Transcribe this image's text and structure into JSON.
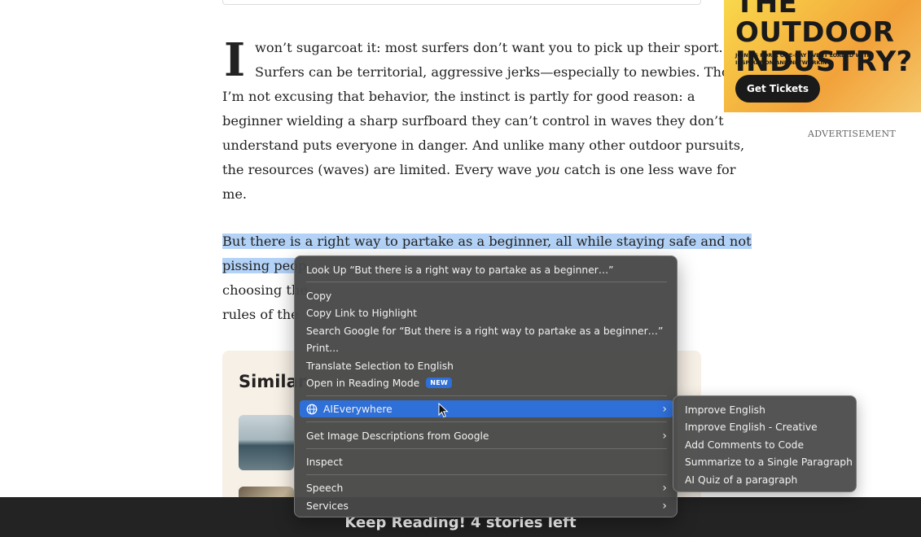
{
  "article": {
    "dropcap": "I",
    "p1_lines": [
      "won’t sugarcoat it: most surfers don’t want you to pick up their sport.",
      "Surfers can be territorial, aggressive jerks—especially to newbies. Though",
      "I’m not excusing that behavior, the instinct is partly for good reason: a",
      "beginner wielding a sharp surfboard they can’t control in waves they don’t",
      "understand puts everyone in danger. And unlike many other outdoor pursuits,",
      "the resources (waves) are limited. Every wave ",
      "you",
      " catch is one less wave for",
      "me."
    ],
    "p2_line1": "But there is a right way to partake as a beginner, all while staying safe and not",
    "p2_line2_hl": "pissing peop",
    "p2_line3": "choosing the",
    "p2_line4": "rules of the"
  },
  "similar": {
    "title": "Similar"
  },
  "ad": {
    "headline_line1": "THE OUTDOOR",
    "headline_line2": "INDUSTRY?",
    "subtext": "JOIN US FOR A ONE-DAY EVENT LOADED WITH INSPIRATION AND NETWORKING.",
    "button": "Get Tickets",
    "label": "ADVERTISEMENT",
    "colors": {
      "bg": "#f9d84b",
      "accent": "#1a1a1a"
    }
  },
  "bottom_bar": {
    "text": "Keep Reading! 4 stories left"
  },
  "context_menu": {
    "lookup": "Look Up “But there is a right way to partake as a beginner…”",
    "copy": "Copy",
    "copy_link": "Copy Link to Highlight",
    "search_google": "Search Google for “But there is a right way to partake as a beginner…”",
    "print": "Print...",
    "translate": "Translate Selection to English",
    "reading_mode": "Open in Reading Mode",
    "reading_mode_badge": "NEW",
    "aieverywhere": "AIEverywhere",
    "image_descriptions": "Get Image Descriptions from Google",
    "inspect": "Inspect",
    "speech": "Speech",
    "services": "Services",
    "highlight_color": "#2f6fd8"
  },
  "submenu": {
    "items": [
      "Improve English",
      "Improve English - Creative",
      "Add Comments to Code",
      "Summarize to a Single Paragraph",
      "AI Quiz of a paragraph"
    ]
  }
}
